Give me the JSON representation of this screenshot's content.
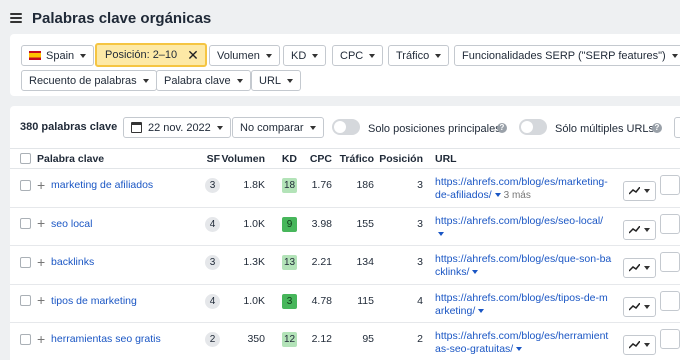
{
  "header": {
    "title": "Palabras clave orgánicas"
  },
  "filters": {
    "row1": [
      {
        "label": "Spain",
        "icon": "spain-flag-icon"
      },
      {
        "label": "Posición: 2–10",
        "active": true
      },
      {
        "label": "Volumen"
      },
      {
        "label": "KD"
      },
      {
        "label": "CPC"
      },
      {
        "label": "Tráfico"
      },
      {
        "label": "Funcionalidades SERP (\"SERP features\")"
      }
    ],
    "row2": [
      {
        "label": "Recuento de palabras"
      },
      {
        "label": "Palabra clave"
      },
      {
        "label": "URL"
      }
    ]
  },
  "toolbar": {
    "count_label": "380 palabras clave",
    "date": "22 nov. 2022",
    "compare": "No comparar",
    "toggle_top": "Solo posiciones principales",
    "toggle_multi": "Sólo múltiples URLs"
  },
  "table": {
    "headers": {
      "keyword": "Palabra clave",
      "sf": "SF",
      "volume": "Volumen",
      "kd": "KD",
      "cpc": "CPC",
      "traffic": "Tráfico",
      "position": "Posición",
      "url": "URL"
    },
    "rows": [
      {
        "keyword": "marketing de afiliados",
        "sf": "3",
        "volume": "1.8K",
        "kd": "18",
        "cpc": "1.76",
        "traffic": "186",
        "position": "3",
        "url": "https://ahrefs.com/blog/es/marketing-de-afiliados/",
        "more": "3 más"
      },
      {
        "keyword": "seo local",
        "sf": "4",
        "volume": "1.0K",
        "kd": "9",
        "cpc": "3.98",
        "traffic": "155",
        "position": "3",
        "url": "https://ahrefs.com/blog/es/seo-local/"
      },
      {
        "keyword": "backlinks",
        "sf": "3",
        "volume": "1.3K",
        "kd": "13",
        "cpc": "2.21",
        "traffic": "134",
        "position": "3",
        "url": "https://ahrefs.com/blog/es/que-son-backlinks/"
      },
      {
        "keyword": "tipos de marketing",
        "sf": "4",
        "volume": "1.0K",
        "kd": "3",
        "cpc": "4.78",
        "traffic": "115",
        "position": "4",
        "url": "https://ahrefs.com/blog/es/tipos-de-marketing/"
      },
      {
        "keyword": "herramientas seo gratis",
        "sf": "2",
        "volume": "350",
        "kd": "12",
        "cpc": "2.12",
        "traffic": "95",
        "position": "2",
        "url": "https://ahrefs.com/blog/es/herramientas-seo-gratuitas/"
      }
    ]
  },
  "colors": {
    "active_filter_bg": "#fde9a6",
    "active_filter_border": "#f5c542",
    "link": "#1a56c4",
    "kd_low": "#47b65b",
    "kd_mid": "#b3e3b8"
  }
}
